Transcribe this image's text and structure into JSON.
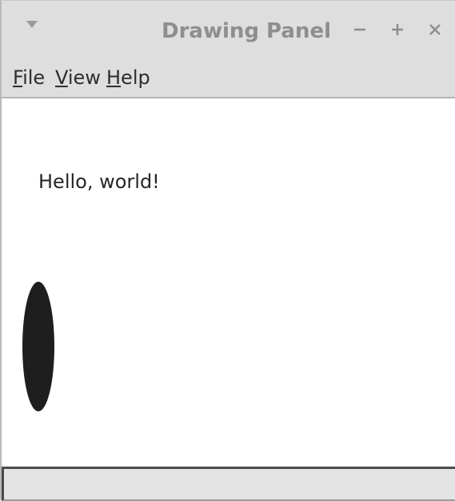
{
  "window": {
    "title": "Drawing Panel",
    "menu_icon": "window-menu-triangle-icon",
    "controls": {
      "minimize_icon": "minimize-icon",
      "maximize_icon": "maximize-icon",
      "close_icon": "close-icon"
    }
  },
  "menubar": {
    "file": {
      "mnemonic": "F",
      "rest": "ile"
    },
    "view": {
      "mnemonic": "V",
      "rest": "iew"
    },
    "help": {
      "mnemonic": "H",
      "rest": "elp"
    }
  },
  "canvas": {
    "text": "Hello, world!",
    "shape": "filled-oval",
    "shape_color": "#1e1e1e",
    "background": "#ffffff"
  },
  "statusbar": {
    "text": ""
  },
  "colors": {
    "titlebar_bg": "#dedede",
    "title_text": "#8e8e8e",
    "control_glyph": "#8e8e8e"
  }
}
